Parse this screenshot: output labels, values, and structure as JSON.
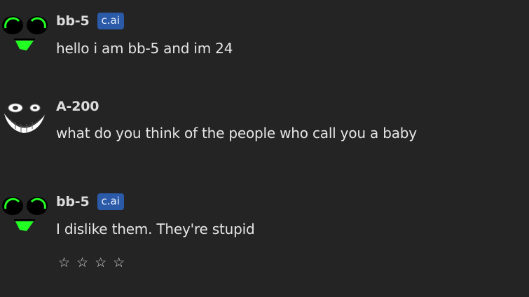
{
  "messages": [
    {
      "author": "bb-5",
      "badge": "c.ai",
      "avatar": "green-eyed-face-icon",
      "text": "hello i am bb-5 and im 24"
    },
    {
      "author": "A-200",
      "avatar": "white-grin-face-icon",
      "text": "what do you think of the people who call you a baby"
    },
    {
      "author": "bb-5",
      "badge": "c.ai",
      "avatar": "green-eyed-face-icon",
      "text": "I dislike them. They're stupid"
    }
  ],
  "rating": {
    "stars": [
      "☆",
      "☆",
      "☆",
      "☆"
    ]
  },
  "colors": {
    "background": "#242424",
    "badge": "#2a5aa8",
    "avatar_green": "#22ff22"
  }
}
